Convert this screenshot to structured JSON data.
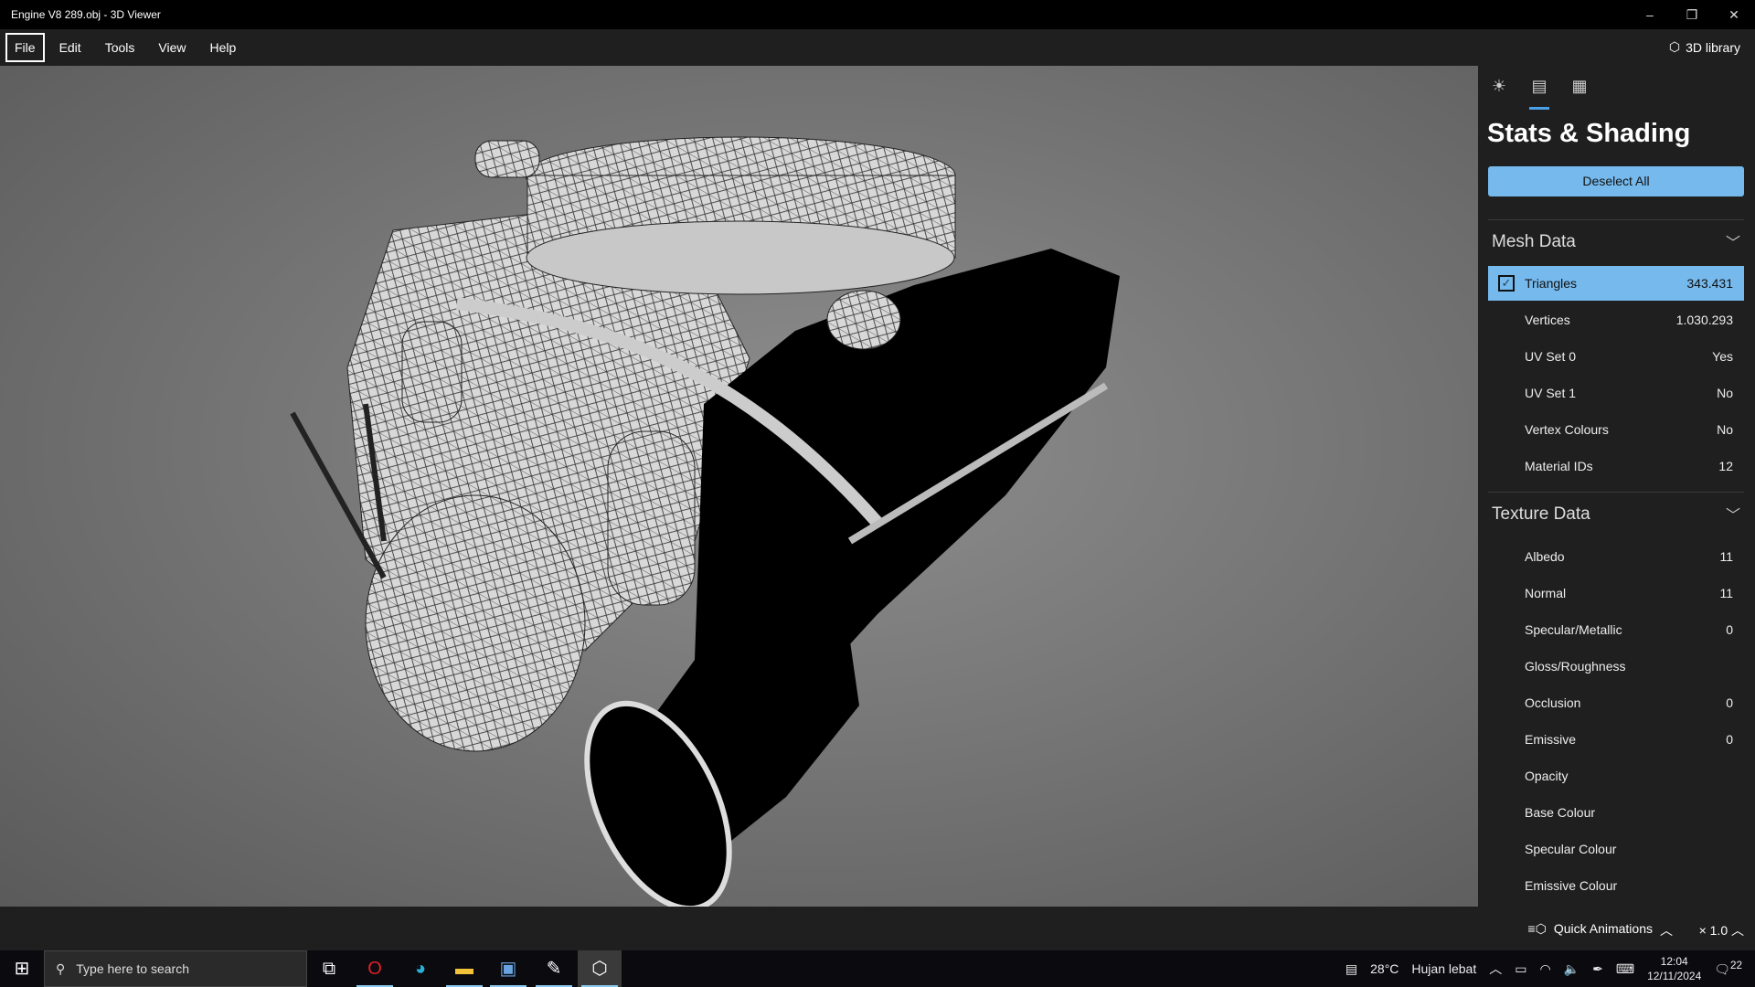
{
  "window": {
    "title": "Engine V8 289.obj - 3D Viewer",
    "minimize": "–",
    "restore": "❐",
    "close": "✕"
  },
  "menu": {
    "items": [
      "File",
      "Edit",
      "Tools",
      "View",
      "Help"
    ],
    "library": "3D library"
  },
  "panel": {
    "tabs": [
      "lighting-tab",
      "stats-tab",
      "grid-tab"
    ],
    "title": "Stats & Shading",
    "deselect": "Deselect All",
    "mesh": {
      "header": "Mesh Data",
      "rows": [
        {
          "label": "Triangles",
          "value": "343.431"
        },
        {
          "label": "Vertices",
          "value": "1.030.293"
        },
        {
          "label": "UV Set 0",
          "value": "Yes"
        },
        {
          "label": "UV Set 1",
          "value": "No"
        },
        {
          "label": "Vertex Colours",
          "value": "No"
        },
        {
          "label": "Material IDs",
          "value": "12"
        }
      ]
    },
    "texture": {
      "header": "Texture Data",
      "rows": [
        {
          "label": "Albedo",
          "value": "11"
        },
        {
          "label": "Normal",
          "value": "11"
        },
        {
          "label": "Specular/Metallic",
          "value": "0"
        },
        {
          "label": "Gloss/Roughness",
          "value": ""
        },
        {
          "label": "Occlusion",
          "value": "0"
        },
        {
          "label": "Emissive",
          "value": "0"
        },
        {
          "label": "Opacity",
          "value": ""
        },
        {
          "label": "Base Colour",
          "value": ""
        },
        {
          "label": "Specular Colour",
          "value": ""
        },
        {
          "label": "Emissive Colour",
          "value": ""
        }
      ]
    }
  },
  "bottom": {
    "quick_animations": "Quick Animations",
    "speed": "× 1.0"
  },
  "taskbar": {
    "search_placeholder": "Type here to search",
    "weather_temp": "28°C",
    "weather_desc": "Hujan lebat",
    "time": "12:04",
    "date": "12/11/2024",
    "notifications": "22"
  },
  "colors": {
    "accent": "#76b9ed"
  }
}
